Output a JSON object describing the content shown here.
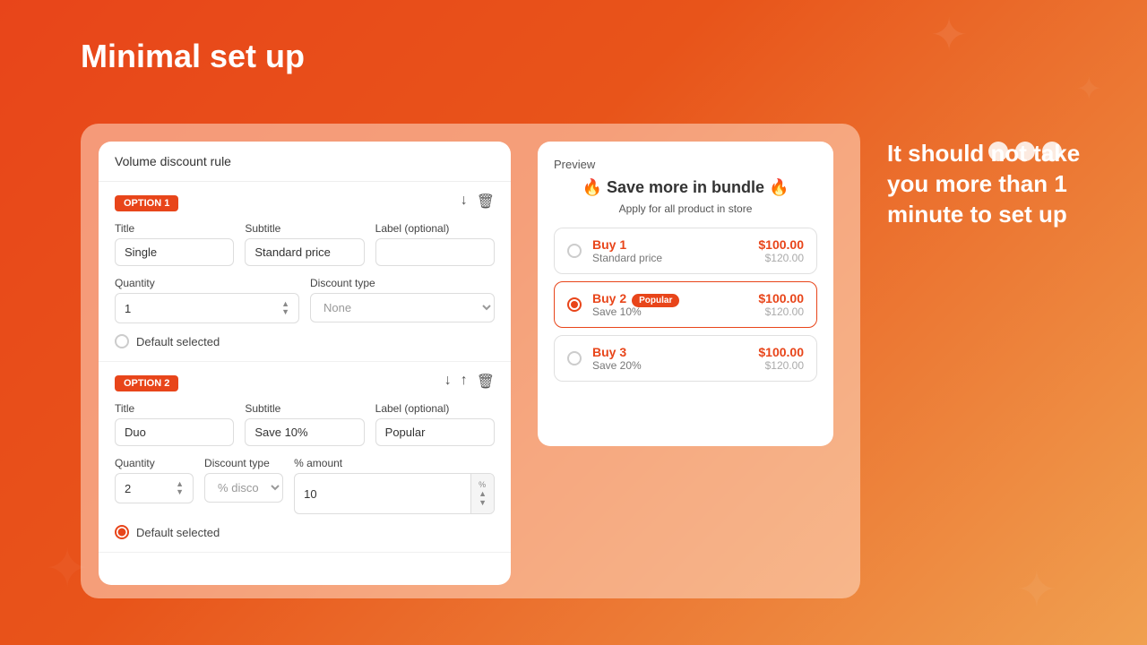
{
  "page": {
    "title": "Minimal set up",
    "background_gradient_start": "#e8451a",
    "background_gradient_end": "#f0a050"
  },
  "right_text": "It should not take you more than 1 minute to set up",
  "panel": {
    "header": "Volume discount rule",
    "option1": {
      "badge": "OPTION 1",
      "title_label": "Title",
      "title_value": "Single",
      "subtitle_label": "Subtitle",
      "subtitle_value": "Standard price",
      "label_label": "Label (optional)",
      "label_value": "",
      "quantity_label": "Quantity",
      "quantity_value": "1",
      "discount_type_label": "Discount type",
      "discount_type_value": "None",
      "default_selected": false,
      "default_label": "Default selected"
    },
    "option2": {
      "badge": "OPTION 2",
      "title_label": "Title",
      "title_value": "Duo",
      "subtitle_label": "Subtitle",
      "subtitle_value": "Save 10%",
      "label_label": "Label (optional)",
      "label_value": "Popular",
      "quantity_label": "Quantity",
      "quantity_value": "2",
      "discount_type_label": "Discount type",
      "discount_type_value": "% discount",
      "percent_amount_label": "% amount",
      "percent_amount_value": "10",
      "default_selected": true,
      "default_label": "Default selected"
    }
  },
  "preview": {
    "label": "Preview",
    "title": "🔥 Save more in bundle 🔥",
    "subtitle": "Apply for all product in store",
    "items": [
      {
        "name": "Buy 1",
        "desc": "Standard price",
        "price": "$100.00",
        "orig_price": "$120.00",
        "selected": false,
        "popular": false,
        "popular_label": ""
      },
      {
        "name": "Buy 2",
        "desc": "Save 10%",
        "price": "$100.00",
        "orig_price": "$120.00",
        "selected": true,
        "popular": true,
        "popular_label": "Popular"
      },
      {
        "name": "Buy 3",
        "desc": "Save 20%",
        "price": "$100.00",
        "orig_price": "$120.00",
        "selected": false,
        "popular": false,
        "popular_label": ""
      }
    ]
  },
  "icons": {
    "move_down": "↓",
    "move_up": "↑",
    "delete": "🗑",
    "spinner_up": "▲",
    "spinner_down": "▼"
  }
}
